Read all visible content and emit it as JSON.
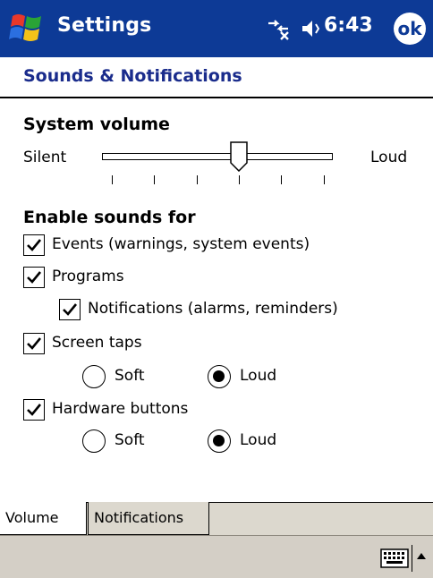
{
  "titlebar": {
    "app_title": "Settings",
    "clock": "6:43",
    "ok_label": "ok",
    "bg_color": "#0d3a96"
  },
  "section": {
    "title": "Sounds & Notifications"
  },
  "volume": {
    "heading": "System volume",
    "min_label": "Silent",
    "max_label": "Loud",
    "level_fraction": 0.6
  },
  "enable": {
    "heading": "Enable sounds for",
    "events_label": "Events (warnings, system events)",
    "events_checked": true,
    "programs_label": "Programs",
    "programs_checked": true,
    "notifications_label": "Notifications (alarms, reminders)",
    "notifications_checked": true,
    "screen_taps_label": "Screen taps",
    "screen_taps_checked": true,
    "screen_taps_soft": "Soft",
    "screen_taps_loud": "Loud",
    "screen_taps_selected": "Loud",
    "hardware_label": "Hardware buttons",
    "hardware_checked": true,
    "hardware_soft": "Soft",
    "hardware_loud": "Loud",
    "hardware_selected": "Loud"
  },
  "tabs": [
    {
      "label": "Volume",
      "active": true
    },
    {
      "label": "Notifications",
      "active": false
    }
  ],
  "cmdbar": {
    "icons": [
      "keyboard-icon",
      "sip-up-arrow-icon"
    ]
  }
}
